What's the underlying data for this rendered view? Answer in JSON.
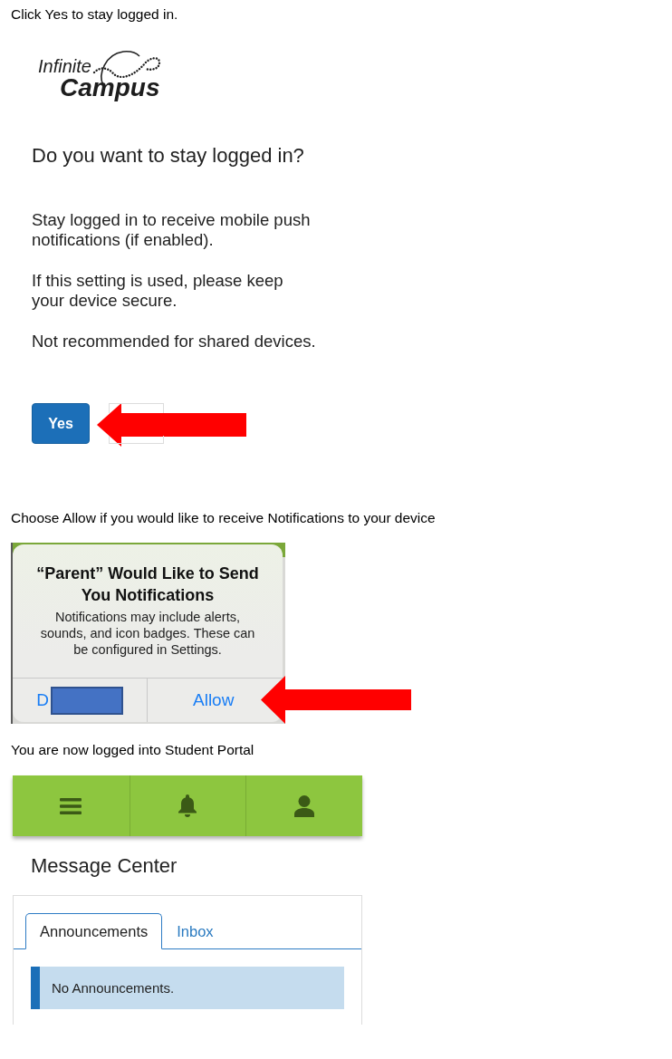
{
  "steps": [
    {
      "kind": "login_prompt",
      "instruction": "Click Yes to stay logged in.",
      "screen": {
        "logo": {
          "line_1": "Infinite",
          "line_2": "Campus"
        },
        "heading": "Do you want to stay logged in?",
        "paragraphs": [
          "Stay logged in to receive mobile push notifications (if enabled).",
          "If this setting is used, please keep your device secure.",
          "Not recommended for shared devices."
        ],
        "button": {
          "label": "Yes"
        }
      }
    },
    {
      "kind": "notification_prompt",
      "instruction": "Choose Allow if you would like to receive Notifications to your device",
      "dialog": {
        "title": "“Parent” Would Like to Send You Notifications",
        "message": "Notifications may include alerts, sounds, and icon badges. These can be configured in Settings.",
        "buttons": [
          {
            "label": "D",
            "redacted": true
          },
          {
            "label": "Allow",
            "redacted": false
          }
        ]
      }
    },
    {
      "kind": "portal",
      "instruction": "You are now logged into Student Portal",
      "screen": {
        "heading": "Message Center",
        "tabs": [
          {
            "label": "Announcements",
            "selected": true
          },
          {
            "label": "Inbox",
            "selected": false
          }
        ],
        "alert": "No Announcements."
      }
    }
  ]
}
